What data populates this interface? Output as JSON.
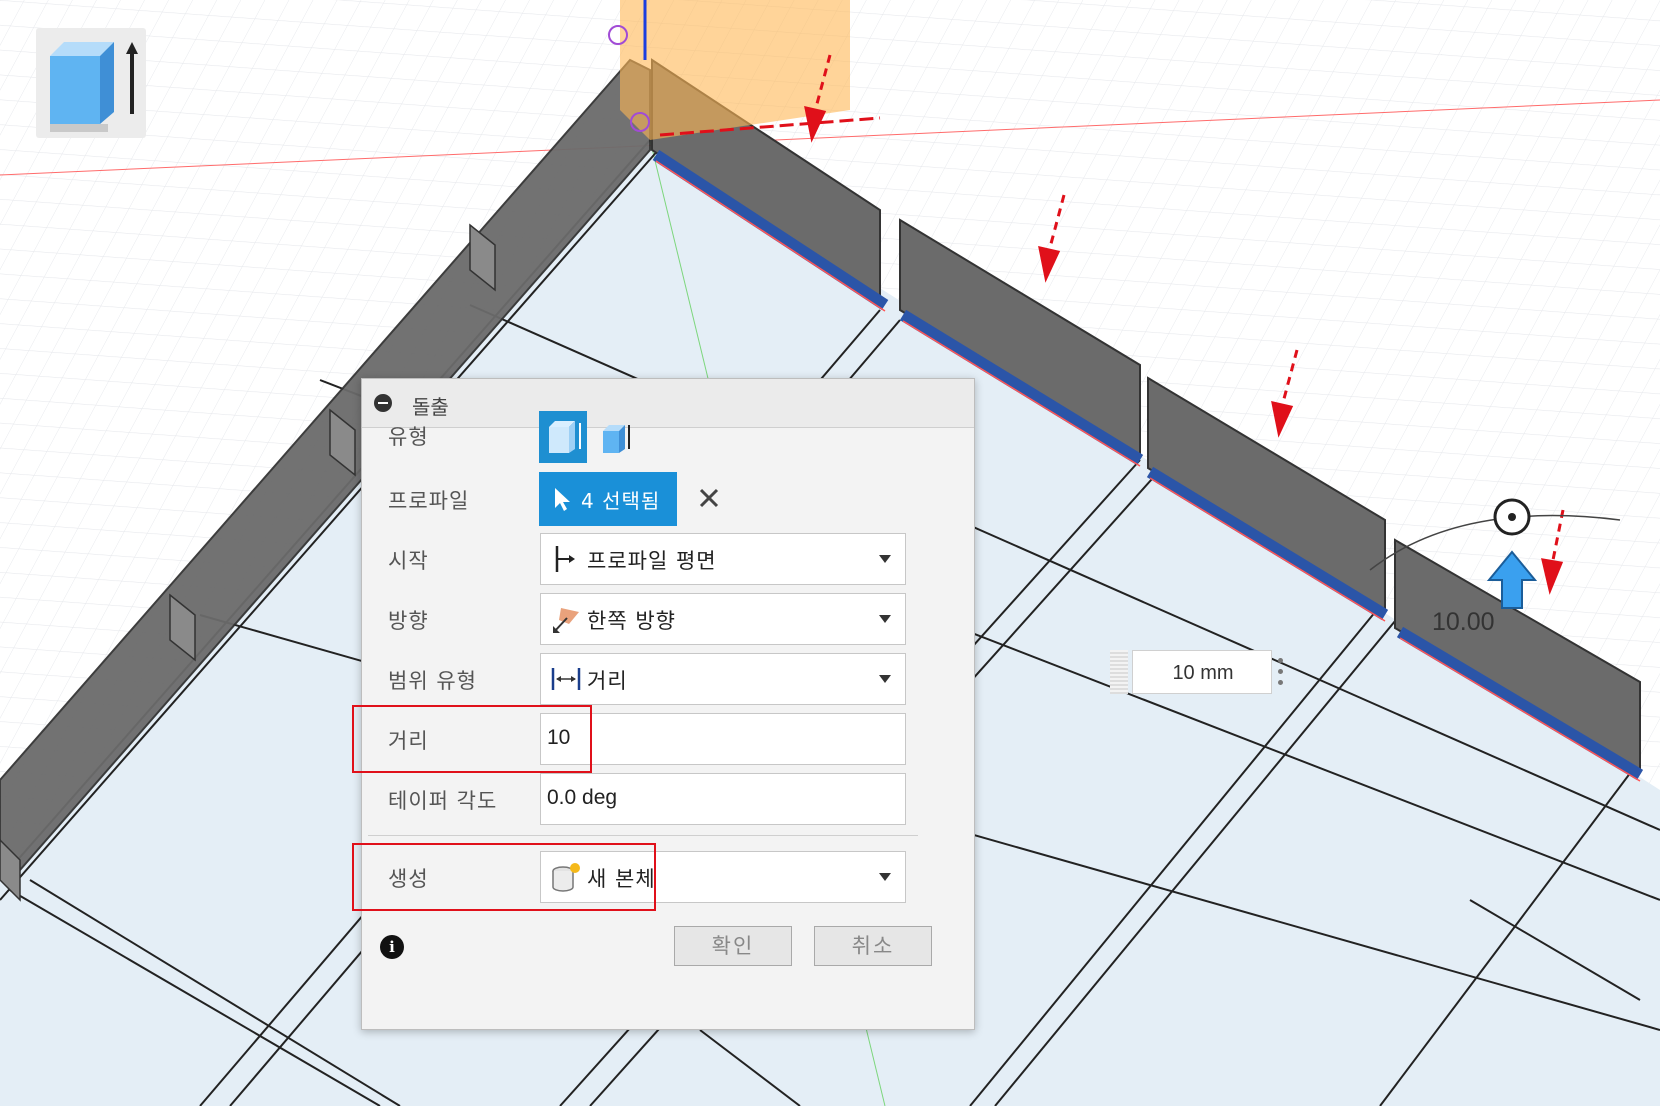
{
  "dialog": {
    "title": "돌출",
    "rows": {
      "type_label": "유형",
      "profile_label": "프로파일",
      "profile_value": "4 선택됨",
      "start_label": "시작",
      "start_value": "프로파일 평면",
      "direction_label": "방향",
      "direction_value": "한쪽 방향",
      "extent_label": "범위 유형",
      "extent_value": "거리",
      "distance_label": "거리",
      "distance_value": "10",
      "taper_label": "테이퍼 각도",
      "taper_value": "0.0 deg",
      "operation_label": "생성",
      "operation_value": "새 본체"
    },
    "ok_label": "확인",
    "cancel_label": "취소"
  },
  "viewport": {
    "measure_input": "10 mm",
    "distance_label": "10.00"
  },
  "icons": [
    "extrude-icon",
    "collapse-icon",
    "one-side-icon",
    "two-side-icon",
    "select-cursor-icon",
    "clear-icon",
    "profile-plane-icon",
    "one-direction-icon",
    "distance-icon",
    "new-body-icon",
    "info-icon",
    "manipulator-arrow-icon",
    "rotation-handle-icon"
  ],
  "colors": {
    "selection": "#1a90d8",
    "highlight": "#e0101a",
    "edge_blue": "#2b55a8",
    "wall": "#6b6b6b",
    "gizmo_orange": "#ffb755"
  }
}
